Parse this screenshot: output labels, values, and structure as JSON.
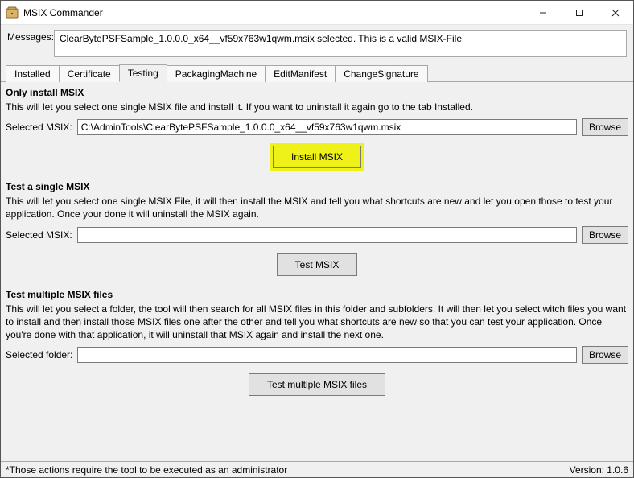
{
  "window": {
    "title": "MSIX Commander",
    "icon_name": "msix-commander-icon"
  },
  "messages": {
    "label": "Messages:",
    "text": "ClearBytePSFSample_1.0.0.0_x64__vf59x763w1qwm.msix selected. This is a valid MSIX-File"
  },
  "tabs": {
    "items": [
      {
        "label": "Installed"
      },
      {
        "label": "Certificate"
      },
      {
        "label": "Testing"
      },
      {
        "label": "PackagingMachine"
      },
      {
        "label": "EditManifest"
      },
      {
        "label": "ChangeSignature"
      }
    ],
    "active_index": 2
  },
  "testing": {
    "only_install": {
      "title": "Only install MSIX",
      "text": "This will let you select one single MSIX file and install it. If you want to uninstall it again go to the tab Installed.",
      "field_label": "Selected MSIX:",
      "field_value": "C:\\AdminTools\\ClearBytePSFSample_1.0.0.0_x64__vf59x763w1qwm.msix",
      "browse_label": "Browse",
      "action_label": "Install MSIX"
    },
    "test_single": {
      "title": "Test a single MSIX",
      "text": "This will let you select one single MSIX File, it will then install the MSIX and tell you what shortcuts are new and let you open those to test your application. Once your done it will uninstall the MSIX again.",
      "field_label": "Selected MSIX:",
      "field_value": "",
      "browse_label": "Browse",
      "action_label": "Test MSIX"
    },
    "test_multiple": {
      "title": "Test multiple MSIX files",
      "text": "This will let you select a folder, the tool will then search for all MSIX files in this folder and subfolders. It will then let you select witch files you want to install and then install those MSIX files one after the other and tell you what shortcuts are new so that you can test your application. Once you're done with that application, it will uninstall that MSIX again and install the next one.",
      "field_label": "Selected folder:",
      "field_value": "",
      "browse_label": "Browse",
      "action_label": "Test multiple MSIX files"
    }
  },
  "status": {
    "left": "*Those actions require the tool to be executed as an administrator",
    "right": "Version: 1.0.6"
  }
}
